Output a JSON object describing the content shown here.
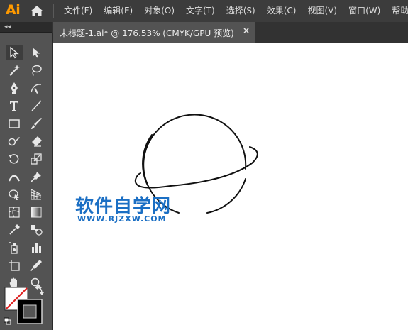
{
  "app": {
    "logo": "Ai"
  },
  "menu": {
    "items": [
      "文件(F)",
      "编辑(E)",
      "对象(O)",
      "文字(T)",
      "选择(S)",
      "效果(C)",
      "视图(V)",
      "窗口(W)",
      "帮助(H)"
    ]
  },
  "document_tab": {
    "title": "未标题-1.ai* @ 176.53% (CMYK/GPU 预览)",
    "close": "×"
  },
  "toolbox": {
    "collapse": "◂◂",
    "tools": [
      "selection-tool-icon",
      "direct-selection-tool-icon",
      "magic-wand-tool-icon",
      "lasso-tool-icon",
      "pen-tool-icon",
      "curvature-tool-icon",
      "type-tool-icon",
      "line-segment-tool-icon",
      "rectangle-tool-icon",
      "paintbrush-tool-icon",
      "shaper-tool-icon",
      "eraser-tool-icon",
      "rotate-tool-icon",
      "scale-tool-icon",
      "width-tool-icon",
      "puppet-warp-tool-icon",
      "shape-builder-tool-icon",
      "perspective-grid-tool-icon",
      "mesh-tool-icon",
      "gradient-tool-icon",
      "eyedropper-tool-icon",
      "blend-tool-icon",
      "symbol-sprayer-tool-icon",
      "column-graph-tool-icon",
      "artboard-tool-icon",
      "slice-tool-icon",
      "hand-tool-icon",
      "zoom-tool-icon"
    ],
    "fill_color": "#ffffff",
    "stroke_color": "#000000"
  },
  "canvas": {
    "watermark_title": "软件自学网",
    "watermark_url": "WWW.RJZXW.COM"
  },
  "colors": {
    "menubar_bg": "#3c3c3c",
    "toolbox_bg": "#535353",
    "logo": "#ff9a00",
    "watermark": "#1b6fc4"
  }
}
